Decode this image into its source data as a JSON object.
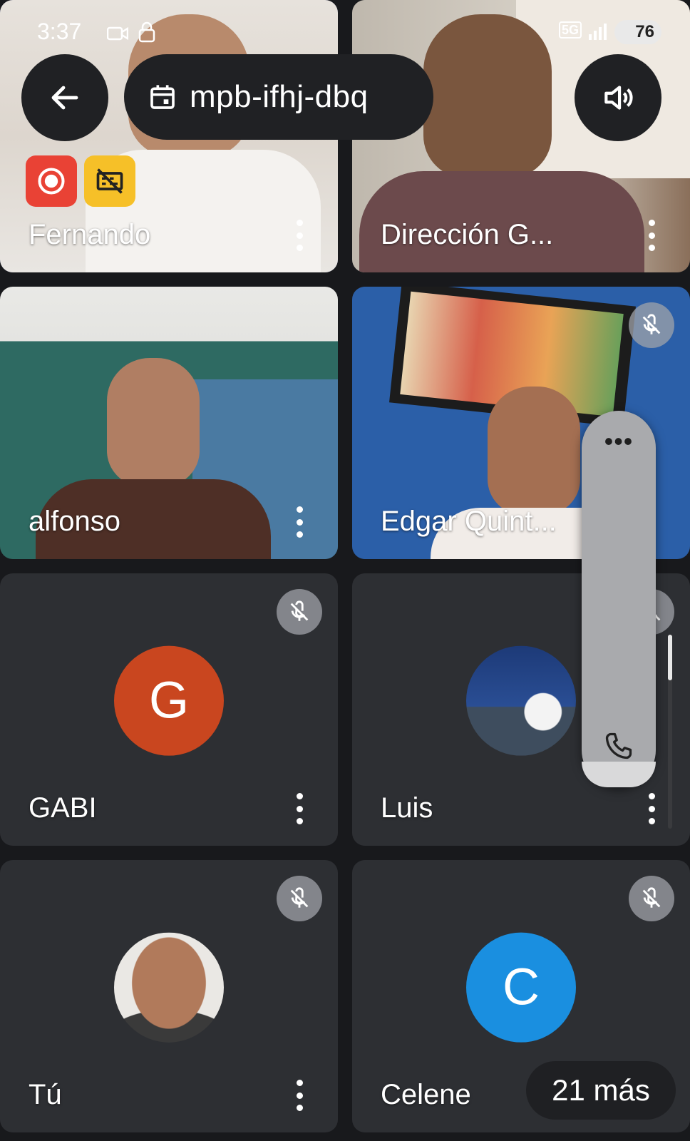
{
  "status_bar": {
    "time": "3:37",
    "network": "5G",
    "battery": "76"
  },
  "meeting": {
    "code": "mpb-ifhj-dbq"
  },
  "tiles": [
    {
      "name": "Fernando"
    },
    {
      "name": "Dirección G..."
    },
    {
      "name": "alfonso"
    },
    {
      "name": "Edgar Quint..."
    },
    {
      "name": "GABI",
      "avatar_letter": "G",
      "avatar_color": "#c9461f"
    },
    {
      "name": "Luis"
    },
    {
      "name": "Tú"
    },
    {
      "name": "Celene",
      "avatar_letter": "C",
      "avatar_color": "#1a8fe0"
    }
  ],
  "overflow": {
    "label": "21 más"
  },
  "overlay": {
    "dots": "•••"
  },
  "icons": {
    "back": "arrow-left-icon",
    "calendar": "calendar-icon",
    "speaker": "volume-icon",
    "record": "record-icon",
    "captions": "captions-off-icon",
    "mute": "mic-off-icon",
    "more": "more-vert-icon",
    "phone": "phone-icon"
  }
}
